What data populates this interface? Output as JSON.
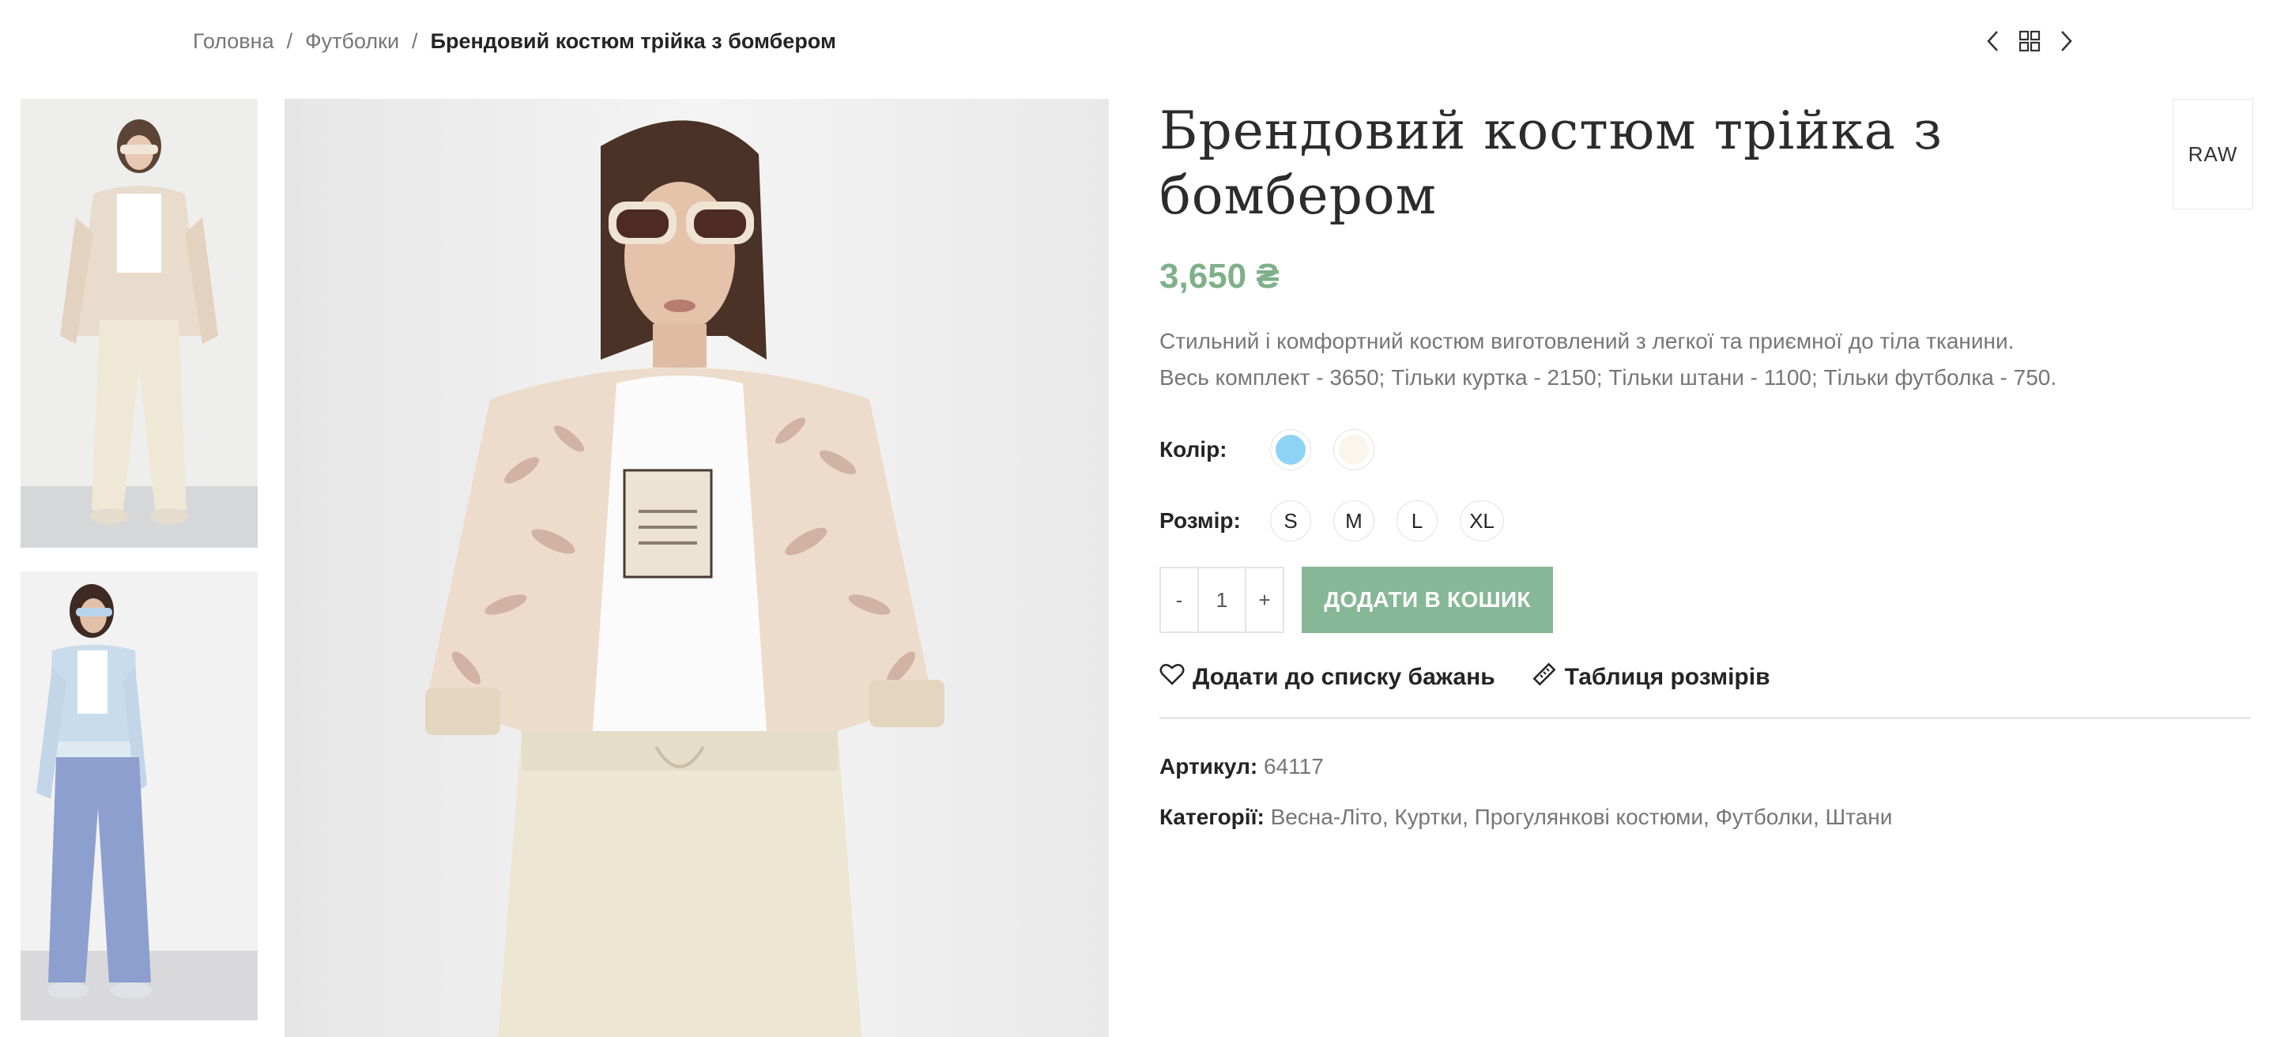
{
  "breadcrumb": {
    "home": "Головна",
    "category": "Футболки",
    "current": "Брендовий костюм трійка з бомбером",
    "separator": "/"
  },
  "product_nav": {
    "prev_icon": "chevron-left-icon",
    "grid_icon": "grid-icon",
    "next_icon": "chevron-right-icon"
  },
  "product": {
    "title": "Брендовий костюм трійка з бомбером",
    "brand": "RAW",
    "price": "3,650 ₴",
    "description_line1": "Стильний і комфортний костюм виготовлений з легкої та приємної до тіла тканини.",
    "description_line2": "Весь комплект - 3650; Тільки куртка - 2150; Тільки штани - 1100; Тільки футболка - 750.",
    "color_label": "Колір",
    "colors": [
      "#8fd3f4",
      "#faf6ec"
    ],
    "size_label": "Розмір",
    "sizes": [
      "S",
      "M",
      "L",
      "XL"
    ],
    "quantity": "1",
    "minus": "-",
    "plus": "+",
    "add_to_cart": "ДОДАТИ В КОШИК",
    "wishlist": "Додати до списку бажань",
    "size_chart": "Таблиця розмірів",
    "sku_label": "Артикул:",
    "sku": "64117",
    "categories_label": "Категорії:",
    "categories": [
      "Весна-Літо",
      "Куртки",
      "Прогулянкові костюми",
      "Футболки",
      "Штани"
    ]
  },
  "colors": {
    "accent": "#86b796",
    "price": "#7fb08a",
    "text": "#242424",
    "muted": "#767676"
  }
}
